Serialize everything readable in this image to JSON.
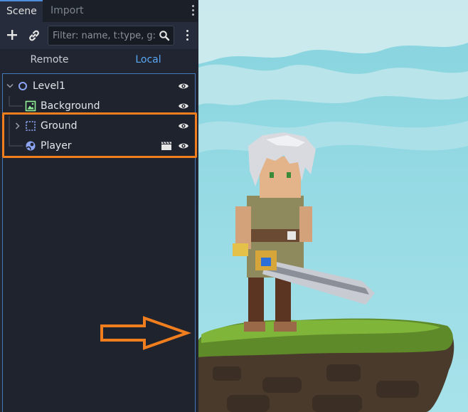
{
  "tabs": [
    {
      "label": "Scene",
      "active": true
    },
    {
      "label": "Import",
      "active": false
    }
  ],
  "toolbar": {
    "add_icon": "plus-icon",
    "link_icon": "link-icon",
    "filter_placeholder": "Filter: name, t:type, g:",
    "search_icon": "search-icon",
    "more_icon": "kebab-menu-icon"
  },
  "mode": {
    "remote_label": "Remote",
    "local_label": "Local",
    "active": "Local"
  },
  "tree": {
    "nodes": [
      {
        "label": "Level1",
        "icon": "node2d-icon",
        "visible": true
      },
      {
        "label": "Background",
        "icon": "sprite2d-icon",
        "visible": true
      },
      {
        "label": "Ground",
        "icon": "tilemap-icon",
        "visible": true,
        "collapsed": true
      },
      {
        "label": "Player",
        "icon": "characterbody2d-icon",
        "visible": true,
        "instanced_scene": true
      }
    ]
  },
  "colors": {
    "accent": "#5aa8f5",
    "highlight": "#f07d1e",
    "panel_bg": "#202531"
  }
}
